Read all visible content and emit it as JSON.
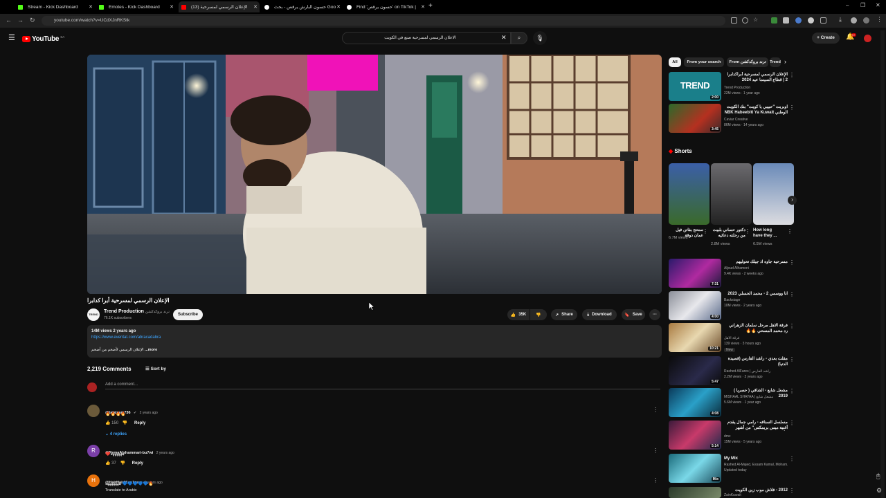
{
  "browser": {
    "tabs": [
      {
        "title": "Stream - Kick Dashboard",
        "color": "#53fc18"
      },
      {
        "title": "Emotes - Kick Dashboard",
        "color": "#53fc18"
      },
      {
        "title": "(13) الإعلان الرسمي لمسرحية",
        "color": "#ff0000"
      },
      {
        "title": "حسون البارش يرقص - بحث Goo",
        "color": "#ffffff"
      },
      {
        "title": "Find 'حسون يرقص' on TikTok |",
        "color": "#ffffff"
      }
    ],
    "url": "youtube.com/watch?v=UCdXJnRKStk"
  },
  "header": {
    "logo_text": "YouTube",
    "country": "SA",
    "search_value": "الاعلان الرسمي لمسرحية صنع في الكويت",
    "create_label": "Create",
    "notification_count": "9+"
  },
  "video": {
    "title": "الإعلان الرسمي لمسرحية أبرا كدابرا",
    "channel": "Trend Production",
    "channel_alt": "ترند بروكدكشن",
    "subscribers": "76.1K subscribers",
    "subscribe_label": "Subscribe",
    "likes": "35K",
    "share_label": "Share",
    "download_label": "Download",
    "save_label": "Save"
  },
  "description": {
    "stats": "14M views  2 years ago",
    "link": "https://www.eventat.com/abracadabra",
    "snippet": "الإعلان الرسمي لأضخم من أضخم",
    "more": "...more"
  },
  "comments": {
    "count_label": "2,219 Comments",
    "sort_label": "Sort by",
    "add_placeholder": "Add a comment...",
    "items": [
      {
        "author": "@talalsam736",
        "time": "2 years ago",
        "text": "🔥🔥🔥🔥",
        "likes": "150",
        "reply": "Reply",
        "replies": "4 replies",
        "avatar_color": "#6b5a3a",
        "initial": ""
      },
      {
        "author": "@RemaAlshammari-bu7wi",
        "time": "2 years ago",
        "text": "ههههههه❤️",
        "likes": "37",
        "reply": "Reply",
        "avatar_color": "#7b3fa8",
        "initial": "R"
      },
      {
        "author": "@HairHair11-m1mm",
        "time": "2 years ago",
        "text": "🔥💙💙💙💙💙 هههههههه",
        "translate": "Translate to Arabic",
        "avatar_color": "#e8720c",
        "initial": "H"
      }
    ]
  },
  "sidebar": {
    "chips": [
      "All",
      "From your search",
      "From ترند بروكدكشن",
      "Trend"
    ],
    "top_videos": [
      {
        "title": "الإعلان الرسمي لمسرحية أبراكدابرا 2 | قطاع السينما عيد 2024",
        "channel": "Trend Production",
        "meta": "22M views · 1 year ago",
        "duration": "2:00",
        "thumb_text": "TREND"
      },
      {
        "title": "اوبريت \"حبيبي يا كويت\" بنك الكويت الوطني NBK Habeebiti Ya Kuwait",
        "channel": "Caviar Creative",
        "meta": "86M views · 14 years ago",
        "duration": "3:45"
      }
    ],
    "shorts_title": "Shorts",
    "shorts": [
      {
        "title": "سنحج بفاتن فيل عمان دوقة",
        "views": "6.7M views"
      },
      {
        "title": "دكتور حساني بلبيت من رحلته دعائيه",
        "views": "2.8M views"
      },
      {
        "title": "How long have they ...",
        "views": "6.5M views"
      }
    ],
    "videos": [
      {
        "title": "مسرحية جاوه اذ جيلك تحوليهم",
        "channel": "Aljoud Alhamoni",
        "meta": "9.4K views · 2 weeks ago",
        "duration": "7:31"
      },
      {
        "title": "انا ووسمي 2 - محمد الحسلي 2023",
        "channel": "Backstage",
        "meta": "10M views · 2 years ago",
        "duration": "4:00"
      },
      {
        "title": "فرقة الاهل مرحل سلمان الزهراني رد محمد المسحي 🔥🔥",
        "channel": "فرقة الاهل",
        "meta": "139 views · 3 hours ago",
        "badge": "New",
        "duration": "10:21"
      },
      {
        "title": "مقلت بعدي - راشد الفارس (قصيدة الدنيا)",
        "channel": "Rashed AlFares | راشد الفارس",
        "meta": "2.2M views · 2 years ago",
        "duration": "5:47"
      },
      {
        "title": "مشعل شايع - الشاقي ( حصرياً ) 2019",
        "channel": "MISHAAL SHAYAA | مشعل شايع",
        "meta": "5.6M views · 1 year ago",
        "duration": "4:08"
      },
      {
        "title": "مسلسل السنافه - رامي جمال يقدم أغنية ميس بريمكس\" من أشهر الأغاني على",
        "channel": "dmc",
        "meta": "15M views · 5 years ago",
        "duration": "5:14"
      },
      {
        "title": "My Mix",
        "channel": "Rashed Al-Majed, Essam Kamal, Moham...",
        "meta": "Updated today",
        "duration": "Mix"
      },
      {
        "title": "2012 - فلاش موب زين الكويت",
        "channel": "ZainKuwait",
        "meta": "",
        "duration": ""
      }
    ]
  },
  "colors": {
    "accent": "#ff0000",
    "link": "#3ea6ff",
    "bg": "#0f0f0f"
  }
}
